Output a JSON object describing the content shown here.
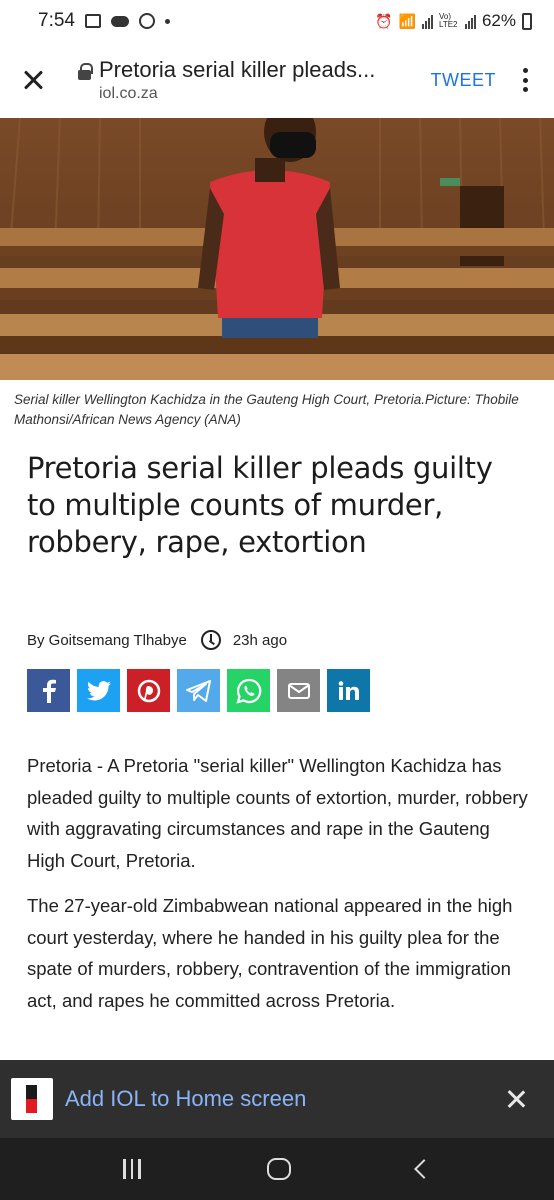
{
  "status_bar": {
    "time": "7:54",
    "battery": "62%",
    "network_label": "Vo) LTE2"
  },
  "toolbar": {
    "title": "Pretoria serial killer pleads...",
    "url": "iol.co.za",
    "tweet_label": "TWEET"
  },
  "article": {
    "image_caption": "Serial killer Wellington Kachidza in the Gauteng High Court, Pretoria.Picture: Thobile Mathonsi/African News Agency (ANA)",
    "headline": "Pretoria serial killer pleads guilty to multiple counts of murder, robbery, rape, extortion",
    "author": "By Goitsemang Tlhabye",
    "time_ago": "23h ago",
    "paragraphs": [
      "Pretoria - A Pretoria \"serial killer\" Wellington Kachidza has pleaded guilty to multiple counts of extortion, murder, robbery with aggravating circumstances and rape in the Gauteng High Court, Pretoria.",
      "The 27-year-old Zimbabwean national appeared in the high court yesterday, where he handed in his guilty plea for the spate of murders, robbery, contravention of the immigration act, and rapes he committed across Pretoria."
    ]
  },
  "share": [
    {
      "name": "facebook-share-button",
      "icon": "facebook-icon",
      "color": "#3b5998"
    },
    {
      "name": "twitter-share-button",
      "icon": "twitter-icon",
      "color": "#1da1f2"
    },
    {
      "name": "pinterest-share-button",
      "icon": "pinterest-icon",
      "color": "#cb2027"
    },
    {
      "name": "telegram-share-button",
      "icon": "telegram-icon",
      "color": "#54a9eb"
    },
    {
      "name": "whatsapp-share-button",
      "icon": "whatsapp-icon",
      "color": "#25d366"
    },
    {
      "name": "email-share-button",
      "icon": "email-icon",
      "color": "#848484"
    },
    {
      "name": "linkedin-share-button",
      "icon": "linkedin-icon",
      "color": "#0e76a8"
    }
  ],
  "add_to_home": {
    "label": "Add IOL to Home screen"
  },
  "colors": {
    "link_blue": "#1a73e8",
    "banner_bg": "#2f2f2f",
    "banner_text": "#8ab4f8",
    "brand_red": "#e21b23"
  }
}
